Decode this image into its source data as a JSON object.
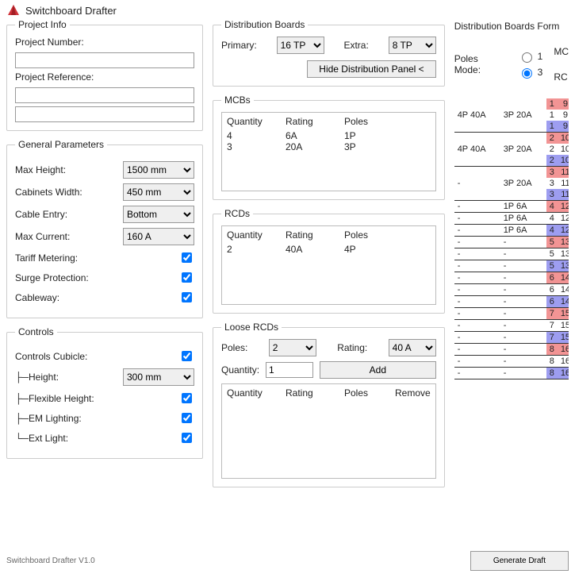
{
  "window_title": "Switchboard Drafter",
  "project_info": {
    "legend": "Project Info",
    "project_number_label": "Project Number:",
    "project_number": "",
    "project_reference_label": "Project Reference:",
    "project_reference_a": "",
    "project_reference_b": ""
  },
  "general": {
    "legend": "General Parameters",
    "max_height_label": "Max Height:",
    "max_height": "1500 mm",
    "cabinets_width_label": "Cabinets Width:",
    "cabinets_width": "450 mm",
    "cable_entry_label": "Cable Entry:",
    "cable_entry": "Bottom",
    "max_current_label": "Max Current:",
    "max_current": "160 A",
    "tariff_label": "Tariff Metering:",
    "tariff": true,
    "surge_label": "Surge Protection:",
    "surge": true,
    "cableway_label": "Cableway:",
    "cableway": true
  },
  "controls": {
    "legend": "Controls",
    "cubicle_label": "Controls Cubicle:",
    "cubicle": true,
    "height_label": "├─Height:",
    "height": "300 mm",
    "flex_height_label": "├─Flexible Height:",
    "flex_height": true,
    "em_label": "├─EM Lighting:",
    "em": true,
    "ext_label": "└─Ext Light:",
    "ext": true
  },
  "dist": {
    "legend": "Distribution Boards",
    "primary_label": "Primary:",
    "primary": "16 TP",
    "extra_label": "Extra:",
    "extra": "8 TP",
    "toggle": "Hide Distribution Panel <"
  },
  "mcbs": {
    "legend": "MCBs",
    "cols": {
      "q": "Quantity",
      "r": "Rating",
      "p": "Poles"
    },
    "rows": [
      {
        "q": "4",
        "r": "6A",
        "p": "1P"
      },
      {
        "q": "3",
        "r": "20A",
        "p": "3P"
      }
    ]
  },
  "rcds": {
    "legend": "RCDs",
    "cols": {
      "q": "Quantity",
      "r": "Rating",
      "p": "Poles"
    },
    "rows": [
      {
        "q": "2",
        "r": "40A",
        "p": "4P"
      }
    ]
  },
  "loose": {
    "legend": "Loose RCDs",
    "poles_label": "Poles:",
    "poles": "2",
    "rating_label": "Rating:",
    "rating": "40 A",
    "qty_label": "Quantity:",
    "qty": "1",
    "add": "Add",
    "cols": {
      "q": "Quantity",
      "r": "Rating",
      "p": "Poles",
      "rm": "Remove"
    }
  },
  "form": {
    "title": "Distribution Boards Form",
    "poles_mode_label": "Poles Mode:",
    "poles_mode": "3",
    "option1": "1",
    "option3": "3",
    "mc_label": "MC",
    "rc_label": "RC",
    "rows": [
      {
        "a": "",
        "b": "",
        "l": 1,
        "r": 9,
        "cl": "red",
        "cr": "red",
        "line": false
      },
      {
        "a": "4P 40A",
        "b": "3P 20A",
        "l": 1,
        "r": 9,
        "cl": "",
        "cr": "",
        "line": false
      },
      {
        "a": "",
        "b": "",
        "l": 1,
        "r": 9,
        "cl": "blue",
        "cr": "blue",
        "line": true
      },
      {
        "a": "",
        "b": "",
        "l": 2,
        "r": 10,
        "cl": "red",
        "cr": "red",
        "line": false
      },
      {
        "a": "4P 40A",
        "b": "3P 20A",
        "l": 2,
        "r": 10,
        "cl": "",
        "cr": "",
        "line": false
      },
      {
        "a": "",
        "b": "",
        "l": 2,
        "r": 10,
        "cl": "blue",
        "cr": "blue",
        "line": true
      },
      {
        "a": "",
        "b": "",
        "l": 3,
        "r": 11,
        "cl": "red",
        "cr": "red",
        "line": false
      },
      {
        "a": "-",
        "b": "3P 20A",
        "l": 3,
        "r": 11,
        "cl": "",
        "cr": "",
        "line": false
      },
      {
        "a": "",
        "b": "",
        "l": 3,
        "r": 11,
        "cl": "blue",
        "cr": "blue",
        "line": true
      },
      {
        "a": "-",
        "b": "1P 6A",
        "l": 4,
        "r": 12,
        "cl": "red",
        "cr": "red",
        "line": true
      },
      {
        "a": "-",
        "b": "1P 6A",
        "l": 4,
        "r": 12,
        "cl": "",
        "cr": "",
        "line": true
      },
      {
        "a": "-",
        "b": "1P 6A",
        "l": 4,
        "r": 12,
        "cl": "blue",
        "cr": "blue",
        "line": true
      },
      {
        "a": "-",
        "b": "-",
        "l": 5,
        "r": 13,
        "cl": "red",
        "cr": "red",
        "line": true
      },
      {
        "a": "-",
        "b": "-",
        "l": 5,
        "r": 13,
        "cl": "",
        "cr": "",
        "line": true
      },
      {
        "a": "-",
        "b": "-",
        "l": 5,
        "r": 13,
        "cl": "blue",
        "cr": "blue",
        "line": true
      },
      {
        "a": "-",
        "b": "-",
        "l": 6,
        "r": 14,
        "cl": "red",
        "cr": "red",
        "line": true
      },
      {
        "a": "-",
        "b": "-",
        "l": 6,
        "r": 14,
        "cl": "",
        "cr": "",
        "line": true
      },
      {
        "a": "-",
        "b": "-",
        "l": 6,
        "r": 14,
        "cl": "blue",
        "cr": "blue",
        "line": true
      },
      {
        "a": "-",
        "b": "-",
        "l": 7,
        "r": 15,
        "cl": "red",
        "cr": "red",
        "line": true
      },
      {
        "a": "-",
        "b": "-",
        "l": 7,
        "r": 15,
        "cl": "",
        "cr": "",
        "line": true
      },
      {
        "a": "-",
        "b": "-",
        "l": 7,
        "r": 15,
        "cl": "blue",
        "cr": "blue",
        "line": true
      },
      {
        "a": "-",
        "b": "-",
        "l": 8,
        "r": 16,
        "cl": "red",
        "cr": "red",
        "line": true
      },
      {
        "a": "-",
        "b": "-",
        "l": 8,
        "r": 16,
        "cl": "",
        "cr": "",
        "line": true
      },
      {
        "a": "-",
        "b": "-",
        "l": 8,
        "r": 16,
        "cl": "blue",
        "cr": "blue",
        "line": true
      }
    ]
  },
  "footer": {
    "version": "Switchboard Drafter V1.0",
    "generate": "Generate Draft"
  }
}
